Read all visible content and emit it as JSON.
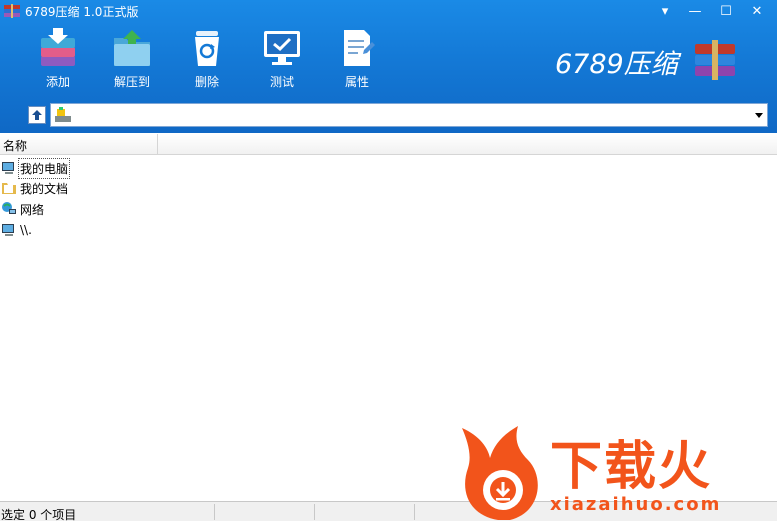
{
  "window": {
    "title": "6789压缩 1.0正式版"
  },
  "window_controls": {
    "menu": "▾",
    "minimize": "—",
    "maximize": "☐",
    "close": "✕"
  },
  "toolbar": {
    "add_label": "添加",
    "extract_label": "解压到",
    "delete_label": "删除",
    "test_label": "测试",
    "properties_label": "属性"
  },
  "brand": {
    "name": "6789压缩"
  },
  "list": {
    "column_name": "名称",
    "items": [
      {
        "label": "我的电脑",
        "icon": "computer-icon"
      },
      {
        "label": "我的文档",
        "icon": "documents-folder-icon"
      },
      {
        "label": "网络",
        "icon": "network-icon"
      },
      {
        "label": "\\\\.",
        "icon": "computer-icon"
      }
    ]
  },
  "status": {
    "text": "选定 0 个项目"
  },
  "watermark": {
    "title": "下载火",
    "url": "xiazaihuo.com"
  },
  "colors": {
    "toolbar_blue": "#1479d6",
    "watermark_orange": "#f2541b"
  }
}
